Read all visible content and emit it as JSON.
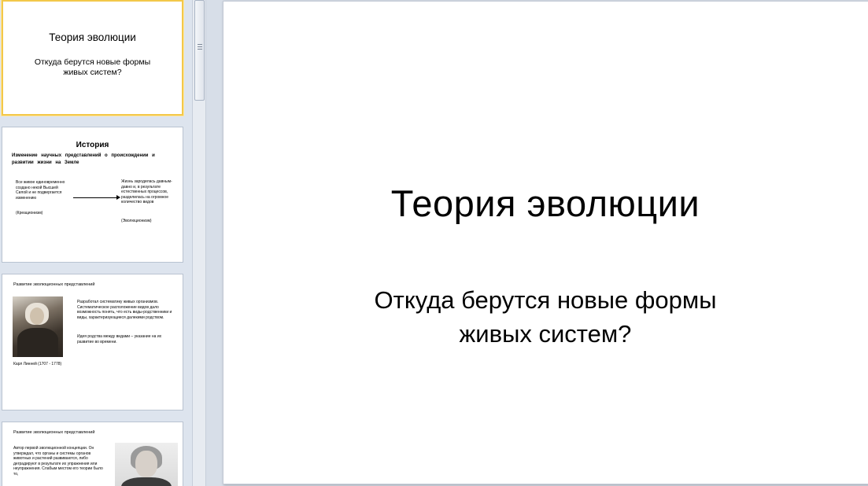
{
  "slides": {
    "slide1": {
      "title": "Теория эволюции",
      "subtitle_line1": "Откуда берутся новые формы",
      "subtitle_line2": "живых систем?"
    },
    "slide2": {
      "title": "История",
      "subtitle": "Изменение научных представлений о происхождении и развитии жизни на Земле",
      "left_text": "Все живое единовременно создано некой Высшей Силой и не подвергается изменению",
      "left_tag": "(Креационизм)",
      "right_text": "Жизнь зародилась давным-давно и, в результате естественных процессов, разделилась на огромное количество видов",
      "right_tag": "(Эволюционизм)"
    },
    "slide3": {
      "heading": "Развитие эволюционных представлений",
      "caption": "Карл Линней (1707 - 1778)",
      "text1": "Разработал систематику живых организмов. Систематическое расположение видов дало возможность понять, что есть виды-родственники и виды, характеризующиеся далекими родством.",
      "text2": "Идея родства между видами – указание на их развитие во времени."
    },
    "slide4": {
      "heading": "Развитие эволюционных представлений",
      "text": "Автор первой эволюционной концепции. Он утверждал, что органы и системы органов животных и растений развиваются, либо деградируют в результате их упражнения или неупражнения. Слабым местом его теории было то,"
    }
  },
  "icons": {
    "scroll_grip": "grip-lines-icon"
  },
  "colors": {
    "selected_border": "#f3c84a",
    "pane_background": "#dde4ee",
    "slide_background": "#ffffff"
  }
}
